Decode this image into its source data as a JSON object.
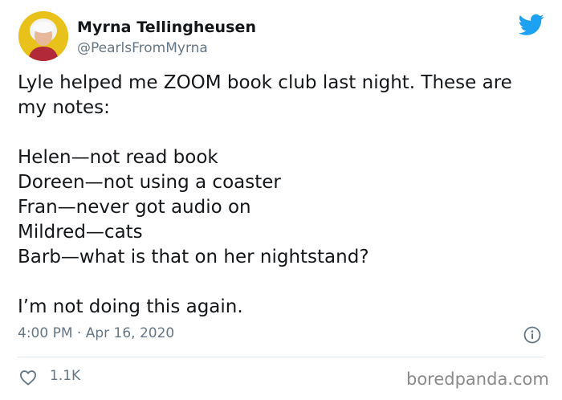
{
  "author": {
    "name": "Myrna Tellingheusen",
    "handle": "@PearlsFromMyrna"
  },
  "tweet": {
    "lines": [
      "Lyle helped me ZOOM book club last night. These are",
      "my notes:",
      "Helen—not read book",
      "Doreen—not using a coaster",
      "Fran—never got audio on",
      "Mildred—cats",
      "Barb—what is that on her nightstand?",
      "I’m not doing this again."
    ],
    "timestamp": "4:00 PM · Apr 16, 2020",
    "likes": "1.1K"
  },
  "watermark": "boredpanda.com",
  "icons": {
    "brand": "twitter-bird-icon",
    "info": "info-icon",
    "like": "heart-icon"
  },
  "colors": {
    "twitter_blue": "#1da1f2",
    "secondary_text": "#657786",
    "avatar_bg": "#e8c21a"
  }
}
